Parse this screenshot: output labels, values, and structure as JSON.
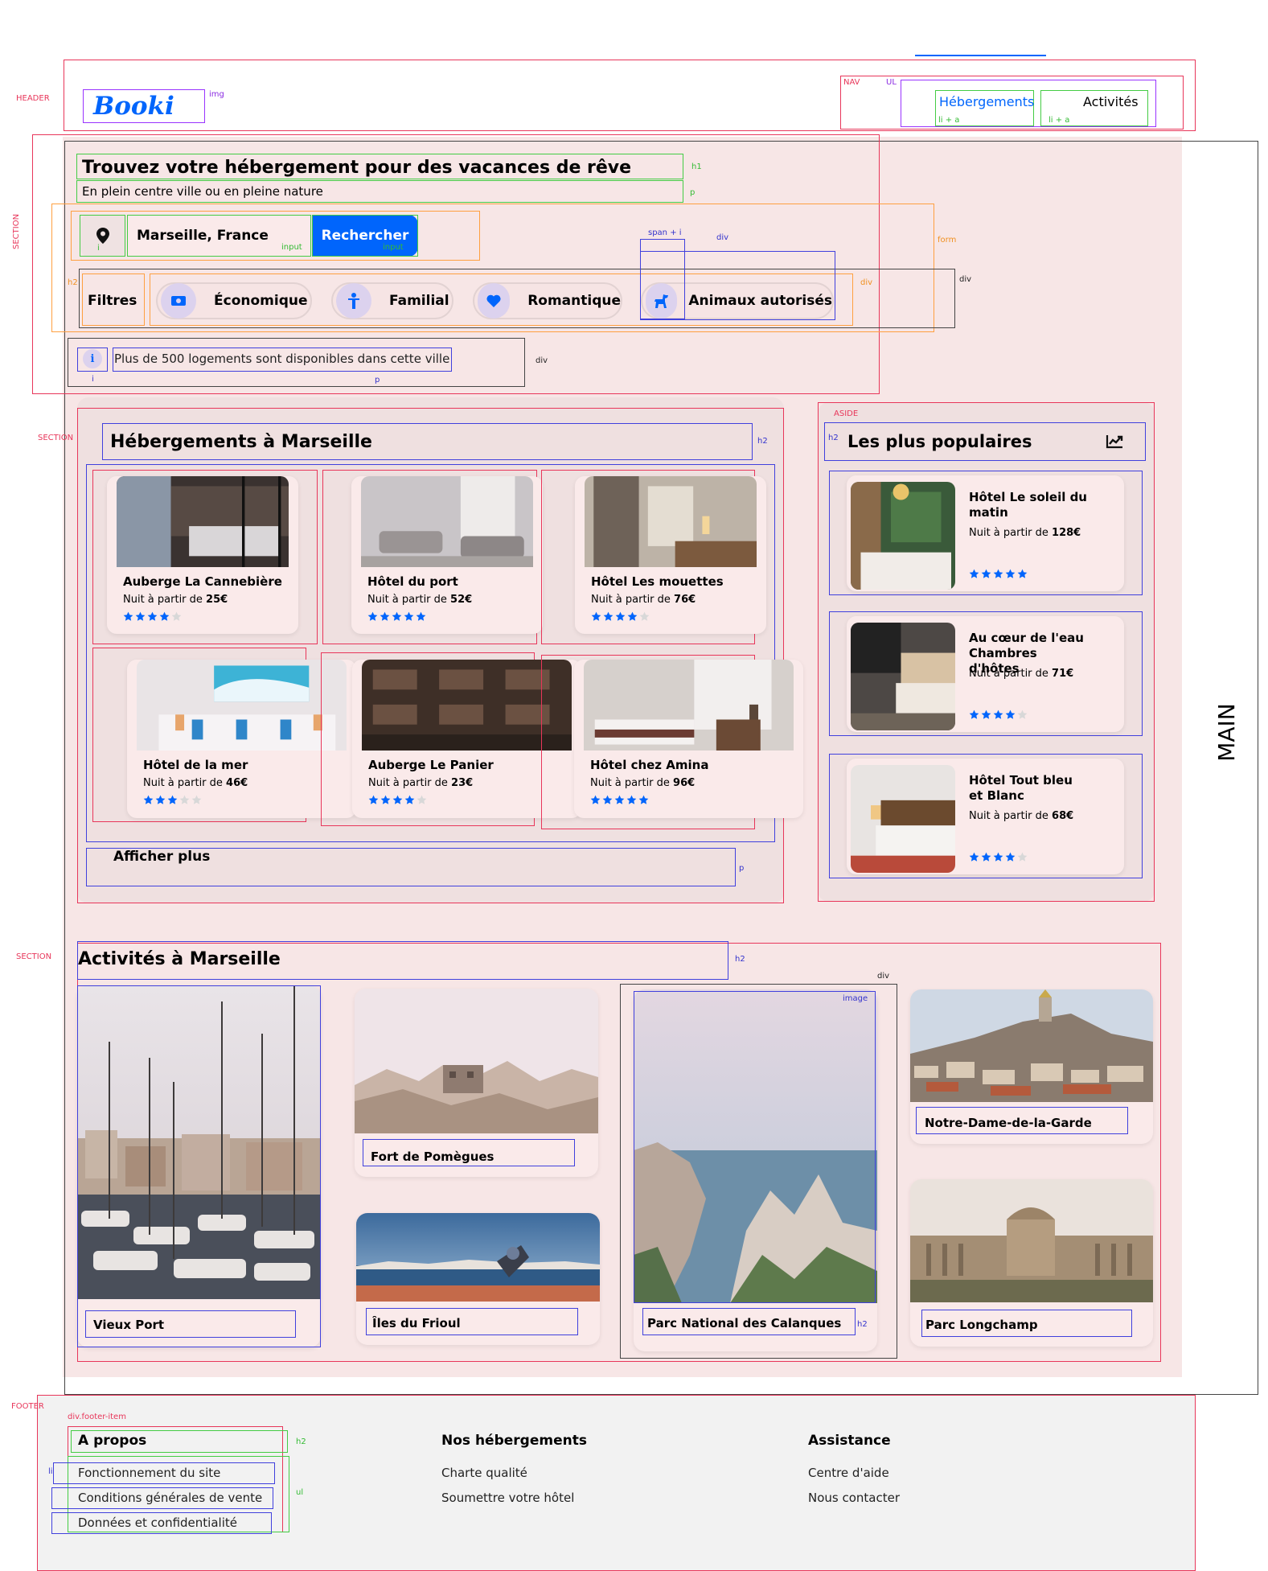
{
  "labels": {
    "header": "HEADER",
    "section_search": "SECTION",
    "section_stays": "SECTION",
    "section_activities": "SECTION",
    "aside": "ASIDE",
    "main": "MAIN",
    "footer": "FOOTER",
    "nav": "NAV",
    "ul": "UL",
    "img": "img",
    "li_a_1": "li + a",
    "li_a_2": "li + a",
    "h1": "h1",
    "p": "p",
    "form": "form",
    "input_1": "input",
    "input_2": "input",
    "i_marker": "i",
    "span_i": "span + i",
    "div": "div",
    "h2": "h2",
    "image": "image",
    "footer_item": "div.footer-item",
    "li": "li",
    "ul_lower": "ul"
  },
  "header": {
    "logo": "Booki",
    "nav": [
      "Hébergements",
      "Activités"
    ]
  },
  "hero": {
    "title": "Trouvez votre hébergement pour des vacances de rêve",
    "subtitle": "En plein centre ville ou en pleine nature",
    "search_value": "Marseille, France",
    "search_button": "Rechercher",
    "filters_title": "Filtres",
    "filters": [
      "Économique",
      "Familial",
      "Romantique",
      "Animaux autorisés"
    ],
    "info": "Plus de 500 logements sont disponibles dans cette ville"
  },
  "stays": {
    "title": "Hébergements à Marseille",
    "items": [
      {
        "name": "Auberge La Cannebière",
        "price_prefix": "Nuit à partir de ",
        "price": "25€",
        "rating": 4
      },
      {
        "name": "Hôtel du port",
        "price_prefix": "Nuit à partir de ",
        "price": "52€",
        "rating": 5
      },
      {
        "name": "Hôtel Les mouettes",
        "price_prefix": "Nuit à partir de ",
        "price": "76€",
        "rating": 4
      },
      {
        "name": "Hôtel de la mer",
        "price_prefix": "Nuit à partir de ",
        "price": "46€",
        "rating": 3
      },
      {
        "name": "Auberge Le Panier",
        "price_prefix": "Nuit à partir de ",
        "price": "23€",
        "rating": 4
      },
      {
        "name": "Hôtel chez Amina",
        "price_prefix": "Nuit à partir de ",
        "price": "96€",
        "rating": 5
      }
    ],
    "more": "Afficher plus"
  },
  "popular": {
    "title": "Les plus populaires",
    "items": [
      {
        "name": "Hôtel Le soleil du matin",
        "price_prefix": "Nuit à partir de ",
        "price": "128€",
        "rating": 5
      },
      {
        "name": "Au cœur de l'eau Chambres d'hôtes",
        "price_prefix": "Nuit à partir de ",
        "price": "71€",
        "rating": 4
      },
      {
        "name": "Hôtel Tout bleu et Blanc",
        "price_prefix": "Nuit à partir de ",
        "price": "68€",
        "rating": 4
      }
    ]
  },
  "activities": {
    "title": "Activités à Marseille",
    "items": [
      "Vieux Port",
      "Fort de Pomègues",
      "Îles du Frioul",
      "Parc National des Calanques",
      "Notre-Dame-de-la-Garde",
      "Parc Longchamp"
    ]
  },
  "footer": {
    "columns": [
      {
        "title": "A propos",
        "links": [
          "Fonctionnement du site",
          "Conditions générales de vente",
          "Données et confidentialité"
        ]
      },
      {
        "title": "Nos hébergements",
        "links": [
          "Charte qualité",
          "Soumettre votre hôtel"
        ]
      },
      {
        "title": "Assistance",
        "links": [
          "Centre d'aide",
          "Nous contacter"
        ]
      }
    ]
  },
  "colors": {
    "accent": "#0065fc",
    "page_bg": "#f7e6e6",
    "star_on": "#0065fc",
    "star_off": "#d8d8d8"
  }
}
